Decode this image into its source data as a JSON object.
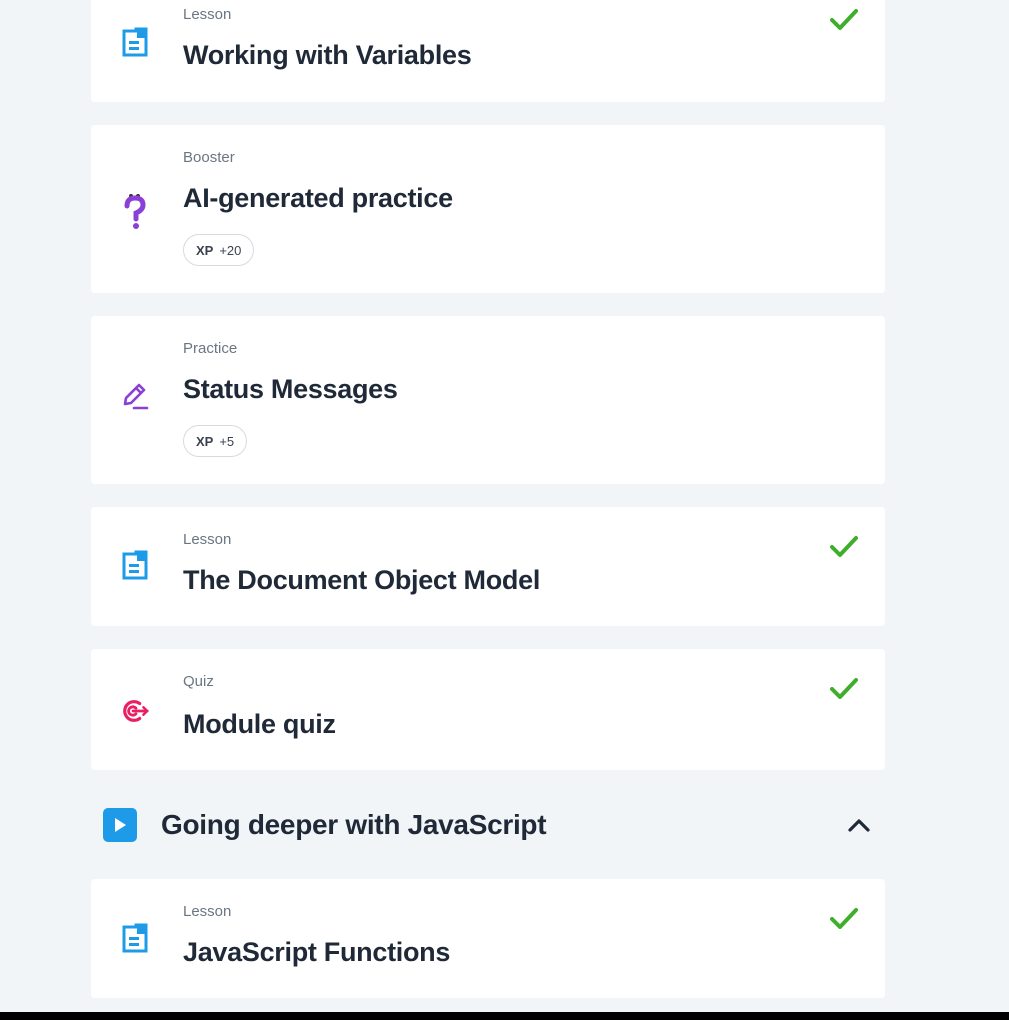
{
  "items": [
    {
      "type": "Lesson",
      "title": "Working with Variables",
      "icon": "lesson-icon",
      "completed": true
    },
    {
      "type": "Booster",
      "title": "AI-generated practice",
      "icon": "question-icon",
      "xp_label": "XP",
      "xp_value": "+20"
    },
    {
      "type": "Practice",
      "title": "Status Messages",
      "icon": "pencil-icon",
      "xp_label": "XP",
      "xp_value": "+5"
    },
    {
      "type": "Lesson",
      "title": "The Document Object Model",
      "icon": "lesson-icon",
      "completed": true
    },
    {
      "type": "Quiz",
      "title": "Module quiz",
      "icon": "target-icon",
      "completed": true
    }
  ],
  "section": {
    "title": "Going deeper with JavaScript",
    "icon": "play-icon",
    "expanded": true
  },
  "section_items": [
    {
      "type": "Lesson",
      "title": "JavaScript Functions",
      "icon": "lesson-icon",
      "completed": true
    }
  ],
  "colors": {
    "background": "#f2f5f8",
    "check": "#3fae2a",
    "lesson": "#1e9be8",
    "booster": "#8a3fd6",
    "quiz": "#e91e63"
  }
}
